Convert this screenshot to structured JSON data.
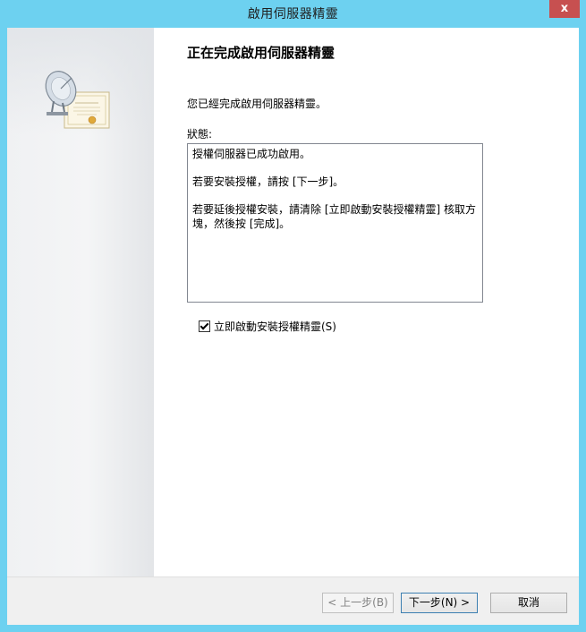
{
  "window": {
    "title": "啟用伺服器精靈",
    "close_label": "x"
  },
  "main": {
    "heading": "正在完成啟用伺服器精靈",
    "description": "您已經完成啟用伺服器精靈。",
    "status_label": "狀態:",
    "status_lines": [
      "授權伺服器已成功啟用。",
      "若要安裝授權，請按 [下一步]。",
      "若要延後授權安裝，請清除 [立即啟動安裝授權精靈] 核取方塊，然後按 [完成]。"
    ],
    "checkbox": {
      "label": "立即啟動安裝授權精靈(S)",
      "checked": true
    }
  },
  "footer": {
    "back_label": "< 上一步(B)",
    "next_label": "下一步(N) >",
    "cancel_label": "取消"
  },
  "colors": {
    "titlebar": "#6dd1f0",
    "close_button": "#c75050"
  },
  "icons": {
    "wizard_graphic": "satellite-dish-certificate-icon"
  }
}
